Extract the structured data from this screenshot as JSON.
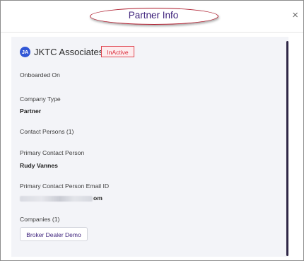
{
  "dialog": {
    "title": "Partner Info",
    "close_icon": "×"
  },
  "partner": {
    "avatar_initials": "JA",
    "name": "JKTC Associates",
    "status_badge": "InActive"
  },
  "fields": {
    "onboarded_on_label": "Onboarded On",
    "company_type_label": "Company Type",
    "company_type_value": "Partner",
    "contact_persons_label": "Contact Persons (1)",
    "primary_contact_label": "Primary Contact Person",
    "primary_contact_value": "Rudy Vannes",
    "primary_email_label": "Primary Contact Person Email ID",
    "primary_email_visible_tail": "om",
    "companies_label": "Companies (1)",
    "companies": [
      "Broker Dealer Demo"
    ]
  },
  "colors": {
    "accent": "#3b1f7a",
    "annotation_circle": "#b01e2f",
    "badge_text": "#d92b3a",
    "avatar_bg": "#3157d6"
  }
}
